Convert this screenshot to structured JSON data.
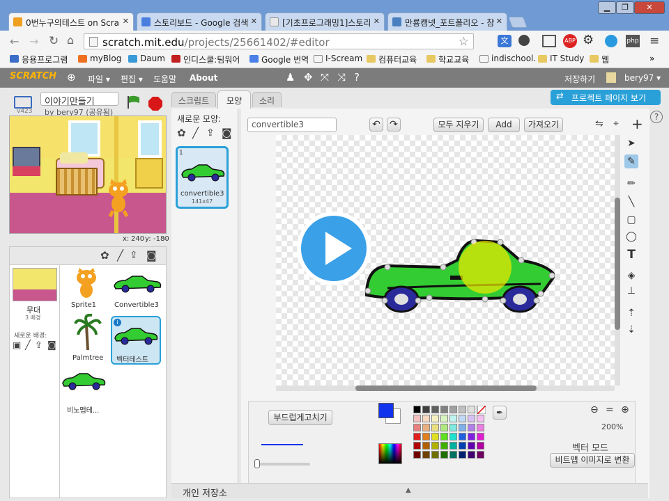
{
  "browser": {
    "tabs": [
      {
        "title": "0번누구의테스트 on Scra",
        "color": "#f0a020"
      },
      {
        "title": "스토리보드 - Google 검색",
        "color": "#4a7fe0"
      },
      {
        "title": "[기초프로그래밍1]스토리",
        "color": "#999999"
      },
      {
        "title": "만룡캠넷_포트폴리오 - 참",
        "color": "#4a80c0"
      }
    ],
    "url_domain": "scratch.mit.edu",
    "url_path": "/projects/25661402/#editor",
    "bookmarks": [
      "응용프로그램",
      "myBlog",
      "Daum",
      "인디스쿨:팀워어",
      "Google 번역",
      "I-Scream",
      "컴퓨터교육",
      "학교교육",
      "indischool.",
      "IT Study",
      "웹"
    ],
    "more": "»"
  },
  "scratch": {
    "logo": "SCRATCH",
    "menu": [
      "파일 ▾",
      "편집 ▾",
      "도움말",
      "About"
    ],
    "save": "저장하기",
    "user": "bery97 ▾",
    "project_title": "이야기만들기",
    "author": "by bery97 (공유됨)",
    "version": "v423",
    "coords": {
      "x_label": "x:",
      "x": "240",
      "y_label": "y:",
      "y": "-180"
    },
    "stage_label": "무대",
    "stage_sub": "3 배경",
    "new_backdrop": "새로운 배경:",
    "sprites": [
      {
        "name": "Sprite1"
      },
      {
        "name": "Convertible3"
      },
      {
        "name": "Palmtree"
      },
      {
        "name": "벡터테스트"
      },
      {
        "name": "비노맵테..."
      }
    ],
    "tabs": [
      "스크립트",
      "모양",
      "소리"
    ],
    "project_page_btn": "프로젝트 페이지 보기",
    "new_costume": "새로운 모양:",
    "costume": {
      "index": "1",
      "name": "convertible3",
      "size": "141x47"
    },
    "costume_name_value": "convertible3",
    "clear": "모두 지우기",
    "add": "Add",
    "import": "가져오기",
    "smooth": "부드럽게고치기",
    "zoom": "200%",
    "mode": "벡터 모드",
    "convert": "비트맵 이미지로 변환",
    "backpack": "개인 저장소",
    "help": "?"
  },
  "colors": {
    "primary": "#1133ee",
    "brand": "#7c7c7c",
    "accent": "#2aa0d8",
    "car": "#33cc33"
  },
  "palette": [
    "#000000",
    "#404040",
    "#606060",
    "#808080",
    "#a0a0a0",
    "#c0c0c0",
    "#e0e0e0",
    "#ffffff",
    "#f4c0c0",
    "#f4d8c0",
    "#f4f0c0",
    "#d8f4c0",
    "#c0f4f0",
    "#c0d8f4",
    "#d8c0f4",
    "#f4c0f0",
    "#e88080",
    "#e8b080",
    "#e8e080",
    "#b0e880",
    "#80e8e0",
    "#80b0e8",
    "#b080e8",
    "#e880e0",
    "#e02020",
    "#e08020",
    "#e0e020",
    "#60e020",
    "#20e0d0",
    "#2060e0",
    "#8020e0",
    "#e020d0",
    "#b00000",
    "#b06000",
    "#b0b000",
    "#40b000",
    "#00b0a0",
    "#0040b0",
    "#6000b0",
    "#b000a0",
    "#700000",
    "#704000",
    "#707000",
    "#207000",
    "#007060",
    "#002070",
    "#400070",
    "#700060"
  ]
}
